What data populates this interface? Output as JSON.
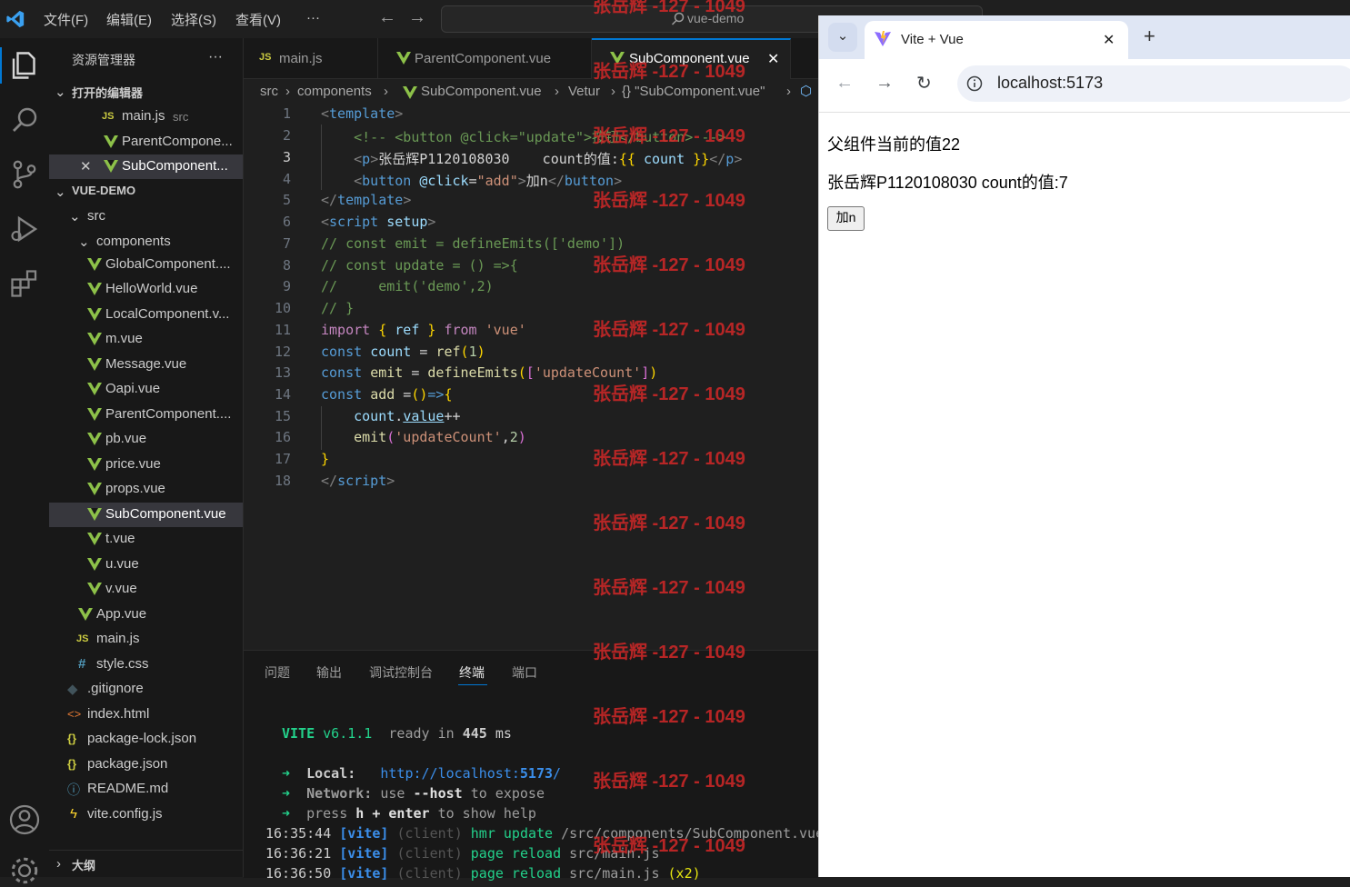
{
  "titlebar": {
    "menus": [
      "文件(F)",
      "编辑(E)",
      "选择(S)",
      "查看(V)",
      "···"
    ],
    "search_text": "vue-demo"
  },
  "sidebar": {
    "title": "资源管理器",
    "more": "···",
    "open_editors_label": "打开的编辑器",
    "open_editors": [
      {
        "name": "main.js",
        "hint": "src"
      },
      {
        "name": "ParentCompone..."
      },
      {
        "name": "SubComponent..."
      }
    ],
    "project_label": "VUE-DEMO",
    "src_label": "src",
    "components_label": "components",
    "components": [
      "GlobalComponent....",
      "HelloWorld.vue",
      "LocalComponent.v...",
      "m.vue",
      "Message.vue",
      "Oapi.vue",
      "ParentComponent....",
      "pb.vue",
      "price.vue",
      "props.vue",
      "SubComponent.vue",
      "t.vue",
      "u.vue",
      "v.vue"
    ],
    "src_files": [
      "App.vue",
      "main.js",
      "style.css"
    ],
    "root_files": [
      ".gitignore",
      "index.html",
      "package-lock.json",
      "package.json",
      "README.md",
      "vite.config.js"
    ],
    "outline_label": "大纲"
  },
  "tabs": [
    {
      "label": "main.js"
    },
    {
      "label": "ParentComponent.vue"
    },
    {
      "label": "SubComponent.vue",
      "close": "✕"
    }
  ],
  "breadcrumb": {
    "parts": [
      "src",
      "components",
      "SubComponent.vue",
      "Vetur",
      "{} \"SubComponent.vue\""
    ]
  },
  "editor": {
    "line_numbers": [
      "1",
      "2",
      "3",
      "4",
      "5",
      "6",
      "7",
      "8",
      "9",
      "10",
      "11",
      "12",
      "13",
      "14",
      "15",
      "16",
      "17",
      "18"
    ],
    "code": {
      "l2_comment": "<!-- <button @click=\"update\">按钮</button> -->",
      "l3_text": "张岳辉P1120108030    count的值:",
      "l4_text": "加n",
      "l7": "// const emit = defineEmits(['demo'])",
      "l8": "// const update = () =>{",
      "l9": "//     emit('demo',2)",
      "l10": "// }"
    }
  },
  "panel": {
    "tabs": [
      "问题",
      "输出",
      "调试控制台",
      "终端",
      "端口"
    ],
    "terminal": {
      "vite_name": "VITE",
      "vite_version": "v6.1.1",
      "ready": "ready in",
      "ready_ms": "445",
      "ms": "ms",
      "local_label": "Local:",
      "local_url_a": "http://localhost:",
      "local_url_port": "5173",
      "local_url_b": "/",
      "network_label": "Network:",
      "network_text_a": "use",
      "network_text_b": "--host",
      "network_text_c": "to expose",
      "help_a": "press",
      "help_b": "h + enter",
      "help_c": "to show help",
      "logs": [
        {
          "time": "16:35:44",
          "tag": "[vite]",
          "src": "(client)",
          "action": "hmr update",
          "file": "/src/components/SubComponent.vue"
        },
        {
          "time": "16:36:21",
          "tag": "[vite]",
          "src": "(client)",
          "action": "page reload",
          "file": "src/main.js"
        },
        {
          "time": "16:36:50",
          "tag": "[vite]",
          "src": "(client)",
          "action": "page reload",
          "file": "src/main.js",
          "extra": "(x2)"
        }
      ]
    }
  },
  "watermark": "张岳辉 -127 - 1049",
  "browser": {
    "tab_title": "Vite + Vue",
    "tab_close": "✕",
    "new_tab": "+",
    "url": "localhost:5173",
    "page": {
      "line1": "父组件当前的值22",
      "line2": "张岳辉P1120108030 count的值:7",
      "button": "加n"
    }
  },
  "colors": {
    "accent": "#0078d4",
    "vue_green": "#8dc149",
    "watermark": "#d22828"
  }
}
